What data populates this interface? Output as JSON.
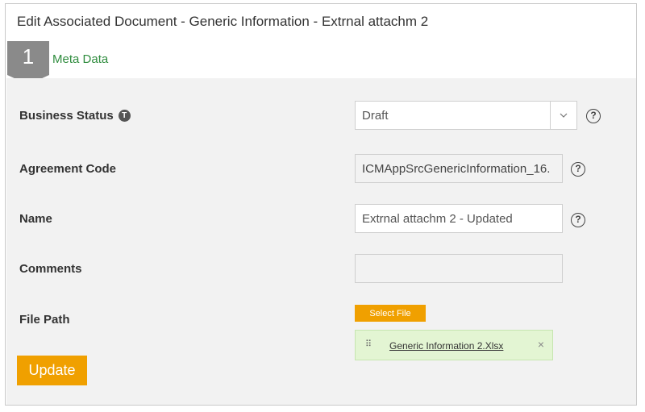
{
  "dialog": {
    "title": "Edit Associated Document - Generic Information - Extrnal attachm 2"
  },
  "tabs": {
    "step_number": "1",
    "active_tab_label": "Meta Data"
  },
  "form": {
    "business_status": {
      "label": "Business Status",
      "badge": "T",
      "value": "Draft",
      "help": "?"
    },
    "agreement_code": {
      "label": "Agreement Code",
      "value": "ICMAppSrcGenericInformation_16.",
      "help": "?"
    },
    "name": {
      "label": "Name",
      "value": "Extrnal attachm 2 - Updated",
      "help": "?"
    },
    "comments": {
      "label": "Comments",
      "value": ""
    },
    "file_path": {
      "label": "File Path",
      "select_file_label": "Select File",
      "file_name": "Generic Information 2.Xlsx",
      "remove_symbol": "×",
      "file_icon": "⠿"
    }
  },
  "actions": {
    "update_label": "Update"
  },
  "colors": {
    "accent_orange": "#f0a000",
    "tab_green": "#2f8c3e",
    "content_bg": "#f2f2f2",
    "file_chip_bg": "#e3f5d3"
  },
  "icons": {
    "caret": "chevron-down-icon",
    "help": "help-circle-icon",
    "badge": "info-badge-icon"
  }
}
